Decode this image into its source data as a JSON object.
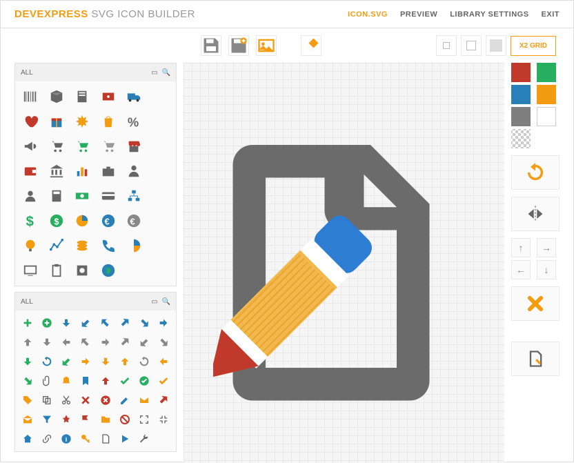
{
  "brand": {
    "main": "DEVEXPRESS",
    "sub": "SVG ICON BUILDER"
  },
  "nav": {
    "icon": "ICON.SVG",
    "preview": "PREVIEW",
    "lib": "LIBRARY SETTINGS",
    "exit": "EXIT"
  },
  "toolbar": {
    "grid_label": "X2 GRID"
  },
  "lib1": {
    "title": "ALL"
  },
  "lib2": {
    "title": "ALL"
  },
  "palette": {
    "colors": [
      "#c0392b",
      "#27ae60",
      "#2980b9",
      "#f39c12",
      "#7f7f7f",
      "#ffffff"
    ],
    "selected_index": 3
  },
  "canvas": {
    "main_icon": "document-edit"
  },
  "chart_data": null
}
